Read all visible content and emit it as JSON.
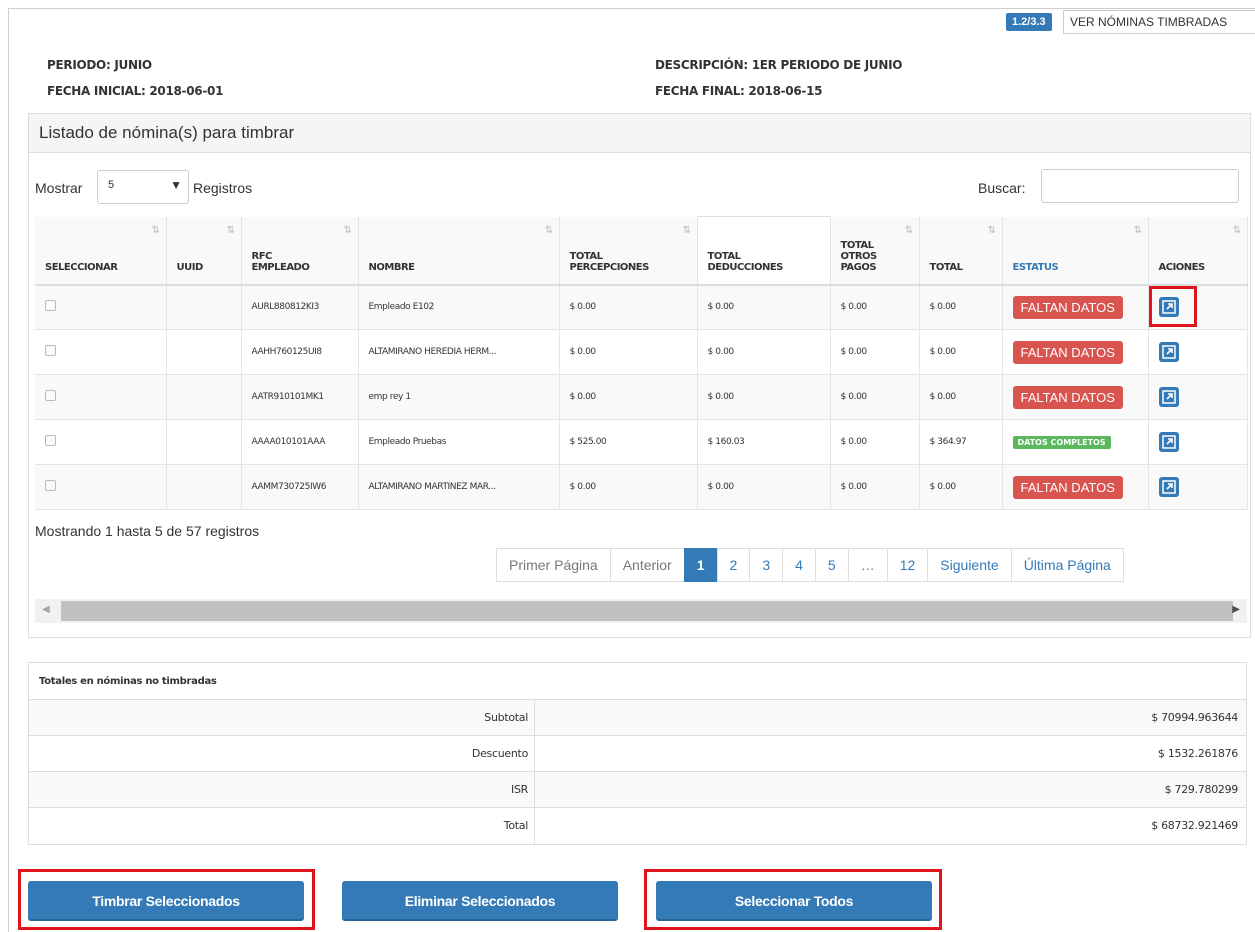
{
  "header": {
    "version_badge": "1.2/3.3",
    "view_button": "VER NÓMINAS TIMBRADAS"
  },
  "period": {
    "periodo": "PERIODO: JUNIO",
    "fecha_inicial": "FECHA INICIAL: 2018-06-01",
    "descripcion": "DESCRIPCIÓN: 1ER PERIODO DE JUNIO",
    "fecha_final": "FECHA FINAL: 2018-06-15"
  },
  "panel": {
    "title": "Listado de nómina(s) para timbrar",
    "show_label": "Mostrar",
    "show_value": "5",
    "records_label": "Registros",
    "search_label": "Buscar:",
    "search_value": ""
  },
  "table": {
    "headers": {
      "seleccionar": "SELECCIONAR",
      "uuid": "UUID",
      "rfc_1": "RFC",
      "rfc_2": "EMPLEADO",
      "nombre": "NOMBRE",
      "perc_1": "TOTAL",
      "perc_2": "PERCEPCIONES",
      "ded_1": "TOTAL",
      "ded_2": "DEDUCCIONES",
      "otro_1": "TOTAL",
      "otro_2": "OTROS",
      "otro_3": "PAGOS",
      "total": "TOTAL",
      "estatus": "ESTATUS",
      "acciones": "ACIONES"
    },
    "rows": [
      {
        "rfc": "AURL880812KI3",
        "nombre": "Empleado E102",
        "perc": "$ 0.00",
        "ded": "$ 0.00",
        "otros": "$ 0.00",
        "total": "$ 0.00",
        "status": "FALTAN DATOS"
      },
      {
        "rfc": "AAHH760125UI8",
        "nombre": "ALTAMIRANO HEREDIA HERM...",
        "perc": "$ 0.00",
        "ded": "$ 0.00",
        "otros": "$ 0.00",
        "total": "$ 0.00",
        "status": "FALTAN DATOS"
      },
      {
        "rfc": "AATR910101MK1",
        "nombre": "emp rey 1",
        "perc": "$ 0.00",
        "ded": "$ 0.00",
        "otros": "$ 0.00",
        "total": "$ 0.00",
        "status": "FALTAN DATOS"
      },
      {
        "rfc": "AAAA010101AAA",
        "nombre": "Empleado Pruebas",
        "perc": "$ 525.00",
        "ded": "$ 160.03",
        "otros": "$ 0.00",
        "total": "$ 364.97",
        "status": "DATOS COMPLETOS"
      },
      {
        "rfc": "AAMM730725IW6",
        "nombre": "ALTAMIRANO MARTINEZ MAR...",
        "perc": "$ 0.00",
        "ded": "$ 0.00",
        "otros": "$ 0.00",
        "total": "$ 0.00",
        "status": "FALTAN DATOS"
      }
    ]
  },
  "footer": {
    "showing": "Mostrando 1 hasta 5 de 57 registros"
  },
  "pagination": {
    "first": "Primer Página",
    "prev": "Anterior",
    "p1": "1",
    "p2": "2",
    "p3": "3",
    "p4": "4",
    "p5": "5",
    "ellipsis": "…",
    "p12": "12",
    "next": "Siguiente",
    "last": "Última Página"
  },
  "totals": {
    "title": "Totales en nóminas no timbradas",
    "subtotal_label": "Subtotal",
    "subtotal_value": "$ 70994.963644",
    "descuento_label": "Descuento",
    "descuento_value": "$ 1532.261876",
    "isr_label": "ISR",
    "isr_value": "$ 729.780299",
    "total_label": "Total",
    "total_value": "$ 68732.921469"
  },
  "actions": {
    "timbrar": "Timbrar Seleccionados",
    "eliminar": "Eliminar Seleccionados",
    "seleccionar": "Seleccionar Todos"
  },
  "colors": {
    "primary": "#337ab7",
    "danger": "#d9534f",
    "success": "#5cb85c",
    "highlight": "#e0141c"
  }
}
